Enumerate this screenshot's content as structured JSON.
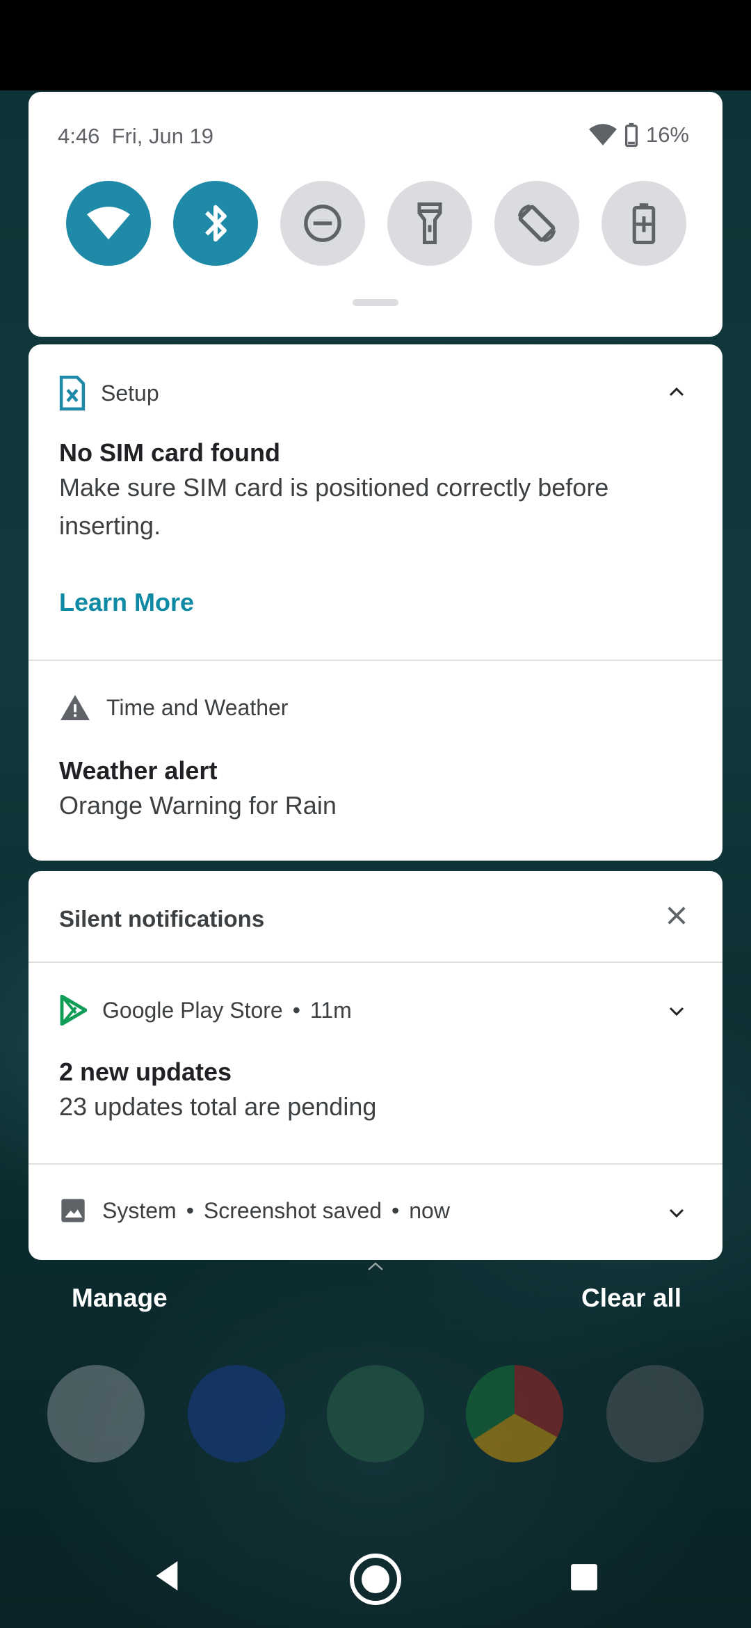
{
  "status": {
    "time": "4:46",
    "date": "Fri, Jun 19",
    "battery": "16%"
  },
  "quick_settings": {
    "tiles": [
      {
        "name": "wifi",
        "icon": "wifi-icon",
        "active": true
      },
      {
        "name": "bluetooth",
        "icon": "bluetooth-icon",
        "active": true
      },
      {
        "name": "do-not-disturb",
        "icon": "minus-circle-icon",
        "active": false
      },
      {
        "name": "flashlight",
        "icon": "flashlight-icon",
        "active": false
      },
      {
        "name": "auto-rotate",
        "icon": "rotate-icon",
        "active": false
      },
      {
        "name": "battery-saver",
        "icon": "battery-plus-icon",
        "active": false
      }
    ],
    "accent": "#1e8aa8"
  },
  "notifications": {
    "setup": {
      "app": "Setup",
      "title": "No SIM card found",
      "body": "Make sure SIM card is positioned correctly before inserting.",
      "action": "Learn More"
    },
    "weather": {
      "app": "Time and Weather",
      "title": "Weather alert",
      "body": "Orange Warning for Rain"
    },
    "silent_header": "Silent notifications",
    "play_store": {
      "app": "Google Play Store",
      "time": "11m",
      "title": "2 new updates",
      "body": "23 updates total are pending"
    },
    "system": {
      "app": "System",
      "text": "Screenshot saved",
      "time": "now"
    }
  },
  "footer": {
    "manage": "Manage",
    "clear_all": "Clear all"
  },
  "dock": [
    "google-folder",
    "messages",
    "motorola",
    "chrome",
    "camera"
  ]
}
